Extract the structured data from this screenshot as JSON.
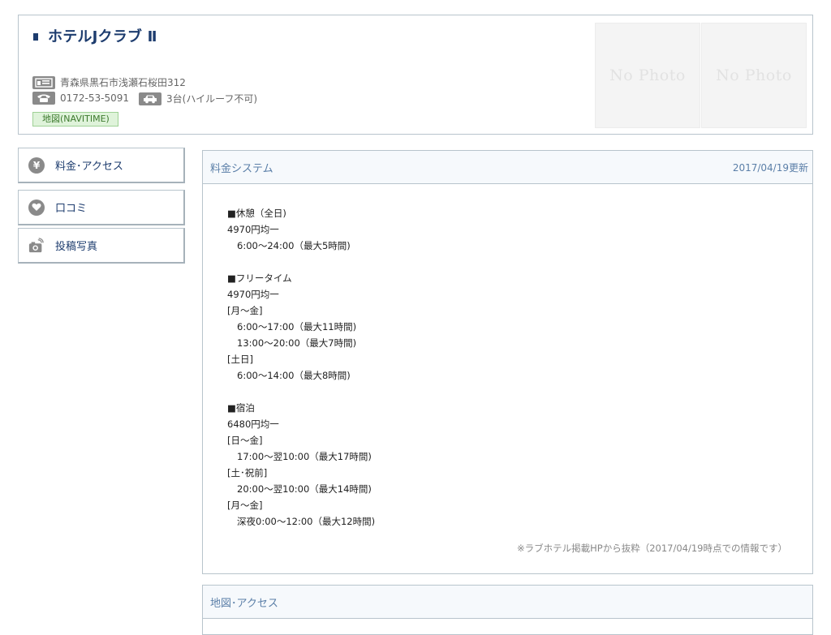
{
  "hotel": {
    "name": "ホテルJクラブ Ⅱ",
    "address": "青森県黒石市浅瀬石桜田312",
    "phone": "0172-53-5091",
    "parking": "3台(ハイルーフ不可)",
    "map_link": "地図(NAVITIME)",
    "photos": [
      "No Photo",
      "No Photo"
    ]
  },
  "icons": {
    "address": "address-icon",
    "phone": "phone-icon",
    "parking": "car-icon",
    "fee": "yen-icon",
    "review": "heart-icon",
    "photos": "camera-icon"
  },
  "sidebar": {
    "items": [
      {
        "label": "料金･アクセス"
      },
      {
        "label": "口コミ"
      },
      {
        "label": "投稿写真"
      }
    ]
  },
  "fee_panel": {
    "title": "料金システム",
    "updated": "2017/04/19更新",
    "lines": [
      "■休憩（全日)",
      "4970円均一",
      "6:00～24:00（最大5時間)",
      "",
      "■フリータイム",
      "4970円均一",
      "[月～金]",
      "6:00～17:00（最大11時間)",
      "13:00～20:00（最大7時間)",
      "[土日]",
      "6:00～14:00（最大8時間)",
      "",
      "■宿泊",
      "6480円均一",
      "[日～金]",
      "17:00～翌10:00（最大17時間)",
      "[土･祝前]",
      "20:00～翌10:00（最大14時間)",
      "[月～金]",
      "深夜0:00～12:00（最大12時間)"
    ],
    "note": "※ラブホテル掲載HPから抜粋（2017/04/19時点での情報です）"
  },
  "map_panel": {
    "title": "地図･アクセス"
  },
  "colors": {
    "title": "#1d3c6e",
    "panel_header": "#5b7fa8",
    "border": "#b8c4cc",
    "map_link_bg": "#dff3da"
  }
}
